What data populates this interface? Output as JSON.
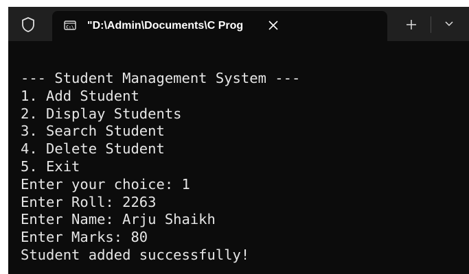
{
  "tabbar": {
    "tab_title": "\"D:\\Admin\\Documents\\C Prog",
    "close_glyph": "✕",
    "new_tab_glyph": "+",
    "dropdown_glyph": "⌄",
    "icons": {
      "profile": "shield-icon",
      "tab": "terminal-icon",
      "close": "close-icon",
      "new_tab": "plus-icon",
      "dropdown": "chevron-down-icon"
    }
  },
  "terminal": {
    "lines": [
      "--- Student Management System ---",
      "1. Add Student",
      "2. Display Students",
      "3. Search Student",
      "4. Delete Student",
      "5. Exit",
      "Enter your choice: 1",
      "Enter Roll: 2263",
      "Enter Name: Arju Shaikh",
      "Enter Marks: 80",
      "Student added successfully!"
    ]
  },
  "colors": {
    "tabbar_bg": "#202020",
    "terminal_bg": "#0c0c0c",
    "text": "#e6e6e6"
  }
}
